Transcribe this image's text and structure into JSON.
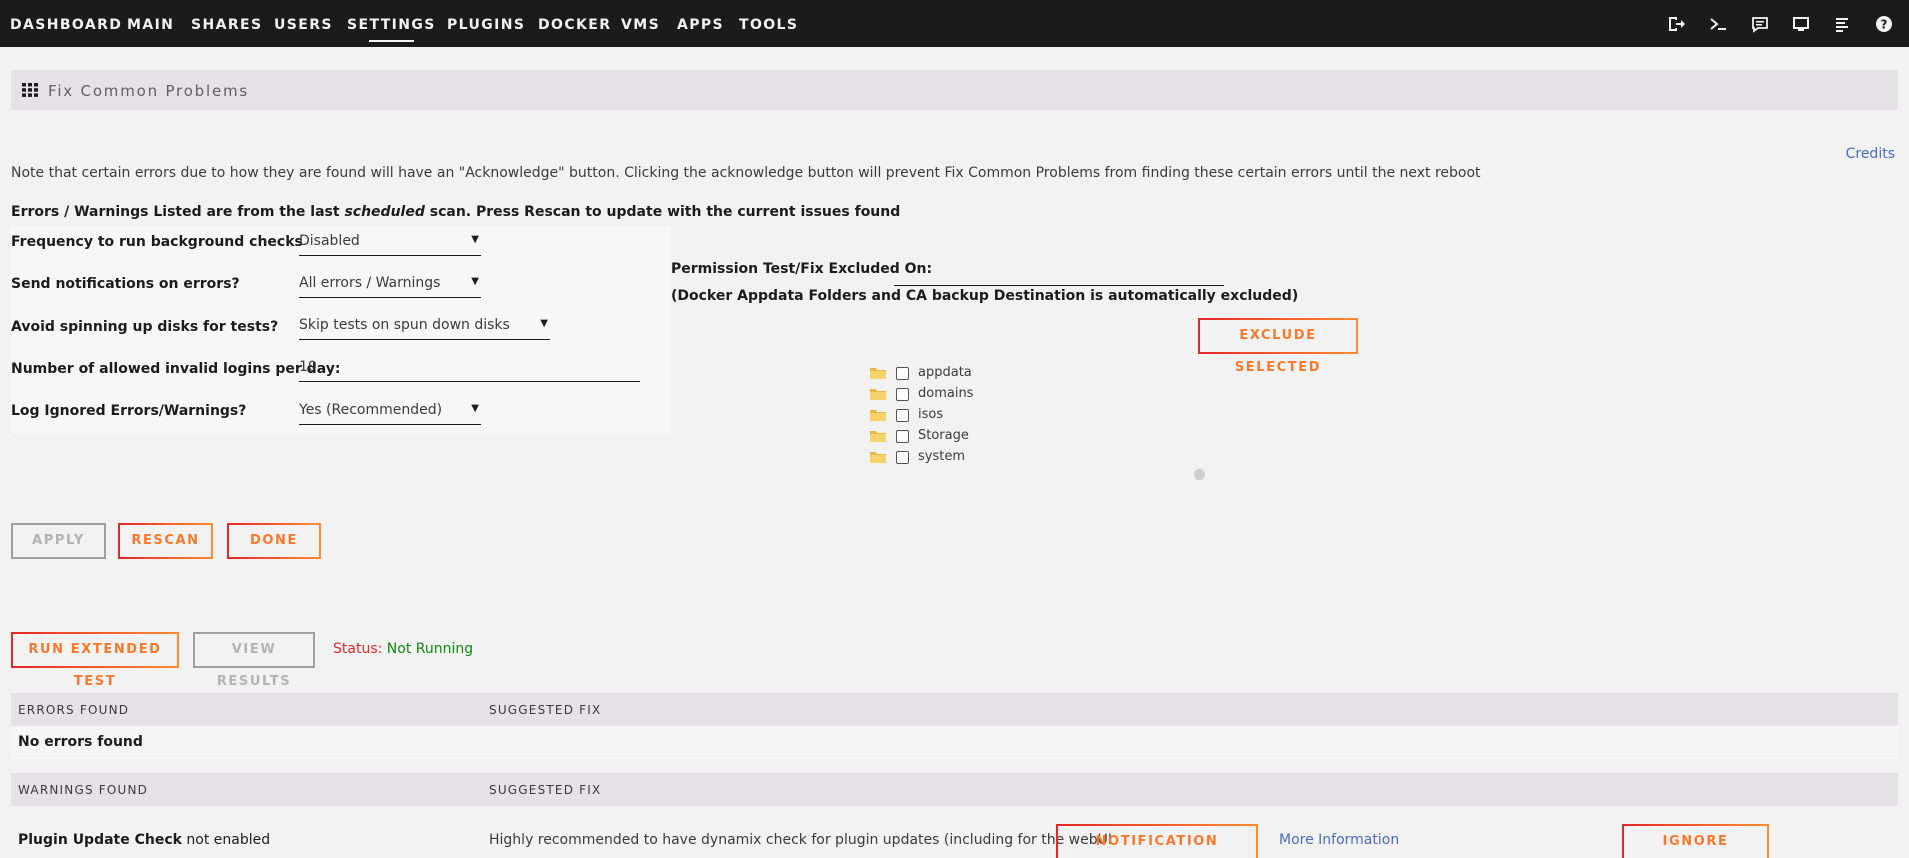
{
  "nav": {
    "items": [
      "DASHBOARD",
      "MAIN",
      "SHARES",
      "USERS",
      "SETTINGS",
      "PLUGINS",
      "DOCKER",
      "VMS",
      "APPS",
      "TOOLS"
    ],
    "active": "SETTINGS",
    "icons": [
      "logout-icon",
      "terminal-icon",
      "feedback-icon",
      "webgui-icon",
      "log-icon",
      "help-icon"
    ]
  },
  "page": {
    "title": "Fix Common Problems",
    "credits": "Credits",
    "note": "Note that certain errors due to how they are found will have an \"Acknowledge\" button. Clicking the acknowledge button will prevent Fix Common Problems from finding these certain errors until the next reboot",
    "last_scan_pre": "Errors / Warnings Listed are from the last ",
    "last_scan_em": "scheduled",
    "last_scan_post": " scan. Press Rescan to update with the current issues found"
  },
  "settings": {
    "frequency": {
      "label": "Frequency to run background checks",
      "value": "Disabled"
    },
    "notifications": {
      "label": "Send notifications on errors?",
      "value": "All errors / Warnings"
    },
    "spinning": {
      "label": "Avoid spinning up disks for tests?",
      "value": "Skip tests on spun down disks"
    },
    "logins": {
      "label": "Number of allowed invalid logins per day:",
      "value": "10"
    },
    "log_ignored": {
      "label": "Log Ignored Errors/Warnings?",
      "value": "Yes (Recommended)"
    }
  },
  "permissions": {
    "label": "Permission Test/Fix Excluded On:",
    "note": "(Docker Appdata Folders and CA backup Destination is automatically excluded)",
    "exclude_button": "EXCLUDE SELECTED",
    "folders": [
      "appdata",
      "domains",
      "isos",
      "Storage",
      "system"
    ]
  },
  "buttons": {
    "apply": "APPLY",
    "rescan": "RESCAN",
    "done": "DONE",
    "run_extended": "RUN EXTENDED TEST",
    "view_results": "VIEW RESULTS"
  },
  "status": {
    "label": "Status:",
    "value": "Not Running"
  },
  "errors_table": {
    "col1": "ERRORS FOUND",
    "col2": "SUGGESTED FIX",
    "empty": "No errors found"
  },
  "warnings_table": {
    "col1": "WARNINGS FOUND",
    "col2": "SUGGESTED FIX",
    "rows": [
      {
        "title": "Plugin Update Check",
        "detail": " not enabled",
        "fix": "Highly recommended to have dynamix check for plugin updates (including for the webUI",
        "button": "NOTIFICATION SETTINGS",
        "link": "More Information",
        "ignore": "IGNORE WARNING"
      }
    ]
  },
  "colors": {
    "accent_from": "#e22828",
    "accent_to": "#ff8c2f",
    "link": "#486dba",
    "status_ok": "#0f8a0f"
  }
}
